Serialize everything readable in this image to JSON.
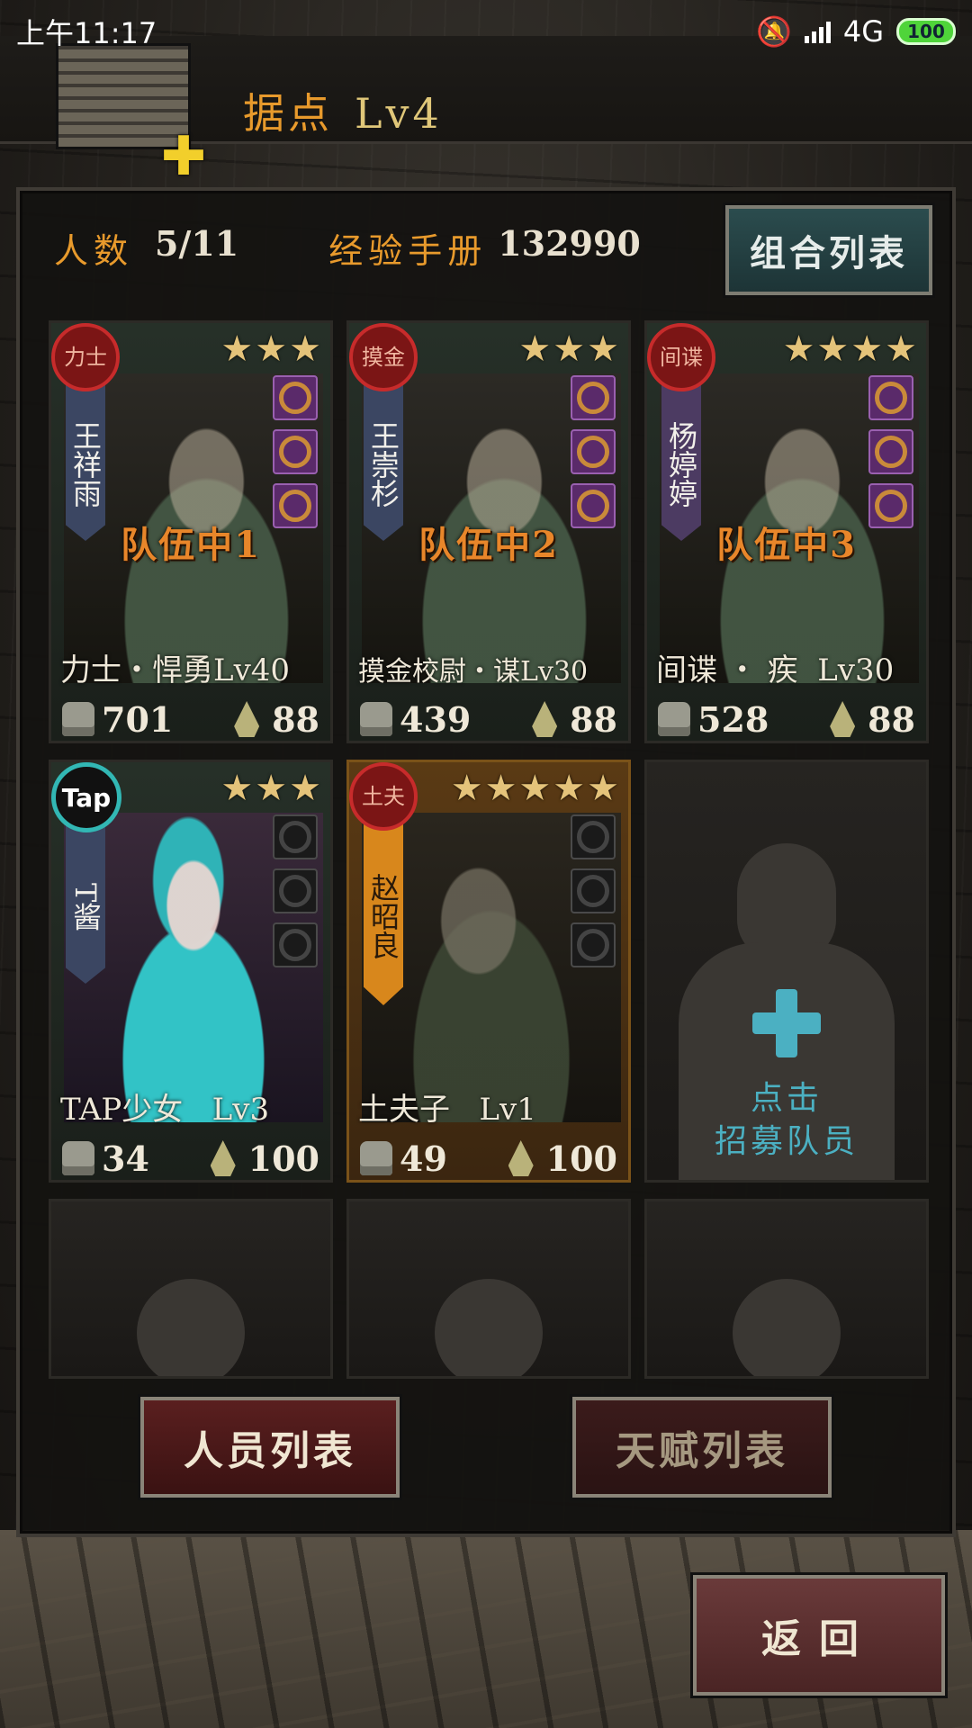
{
  "status_bar": {
    "time": "上午11:17",
    "network": "4G",
    "battery": "100"
  },
  "header": {
    "title": "据点",
    "level": "Lv4"
  },
  "stats": {
    "count_label": "人数",
    "count_value": "5/11",
    "exp_label": "经验手册",
    "exp_value": "132990"
  },
  "combo_button": "组合列表",
  "characters": [
    {
      "class_seal": "力士",
      "name": "王祥雨",
      "stars": "★★★",
      "team": "队伍中1",
      "title": "力士・悍勇Lv40",
      "power": "701",
      "stamina": "88"
    },
    {
      "class_seal": "摸金",
      "name": "王崇杉",
      "stars": "★★★",
      "team": "队伍中2",
      "title": "摸金校尉・谋Lv30",
      "power": "439",
      "stamina": "88"
    },
    {
      "class_seal": "间谍",
      "name": "杨婷婷",
      "stars": "★★★★",
      "team": "队伍中3",
      "title": "间谍 ・ 疾  Lv30",
      "power": "528",
      "stamina": "88"
    },
    {
      "class_seal": "Tap",
      "name": "T酱",
      "stars": "★★★",
      "team": "",
      "title": "TAP少女   Lv3",
      "power": "34",
      "stamina": "100"
    },
    {
      "class_seal": "土夫",
      "name": "赵昭良",
      "stars": "★★★★★",
      "team": "",
      "title": "土夫子   Lv1",
      "power": "49",
      "stamina": "100"
    }
  ],
  "recruit": {
    "line1": "点击",
    "line2": "招募队员"
  },
  "buttons": {
    "staff_list": "人员列表",
    "talent_list": "天赋列表",
    "back": "返回"
  }
}
